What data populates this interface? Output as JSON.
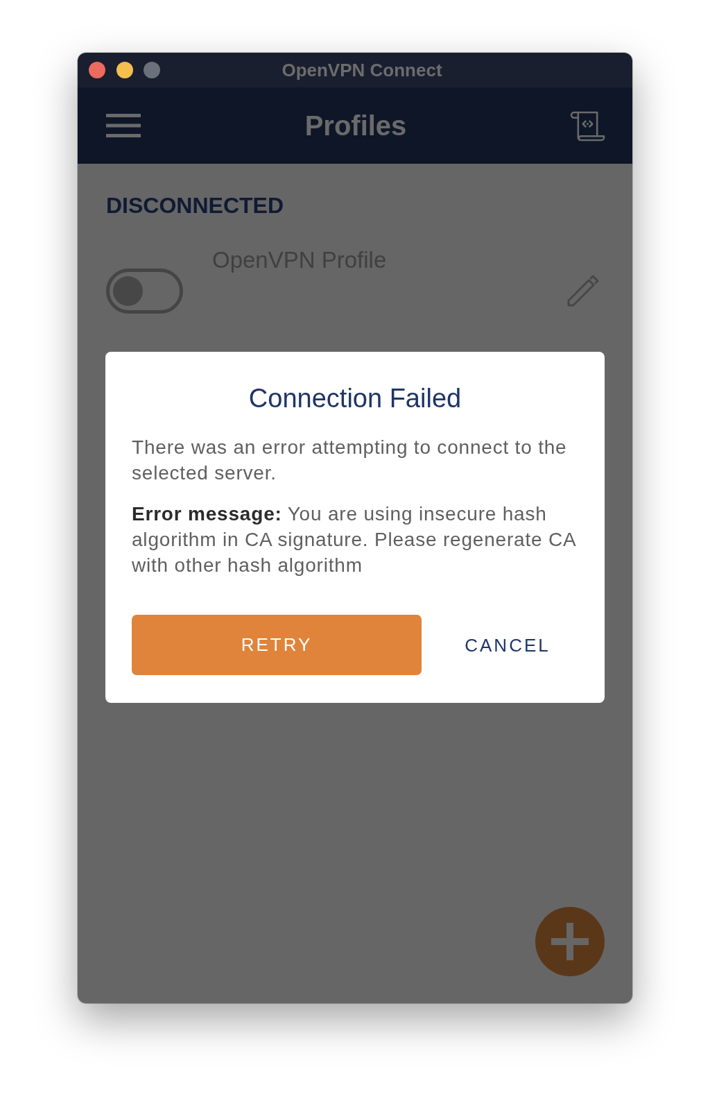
{
  "window": {
    "title": "OpenVPN Connect",
    "buttons": [
      {
        "color": "#ec6a5e"
      },
      {
        "color": "#f4bf4f"
      },
      {
        "color": "#6c707b"
      }
    ]
  },
  "header": {
    "title": "Profiles"
  },
  "status": "DISCONNECTED",
  "profiles": [
    {
      "name": "OpenVPN Profile",
      "on": false
    }
  ],
  "dialog": {
    "title": "Connection Failed",
    "paragraphs": [
      "There was an error attempting to connect to the selected server.",
      "**Error message:** You are using insecure hash algorithm in CA signature. Please regenerate CA with other hash algorithm"
    ],
    "buttons": [
      {
        "label": "RETRY",
        "kind": "filled"
      },
      {
        "label": "CANCEL",
        "kind": "text"
      }
    ]
  }
}
